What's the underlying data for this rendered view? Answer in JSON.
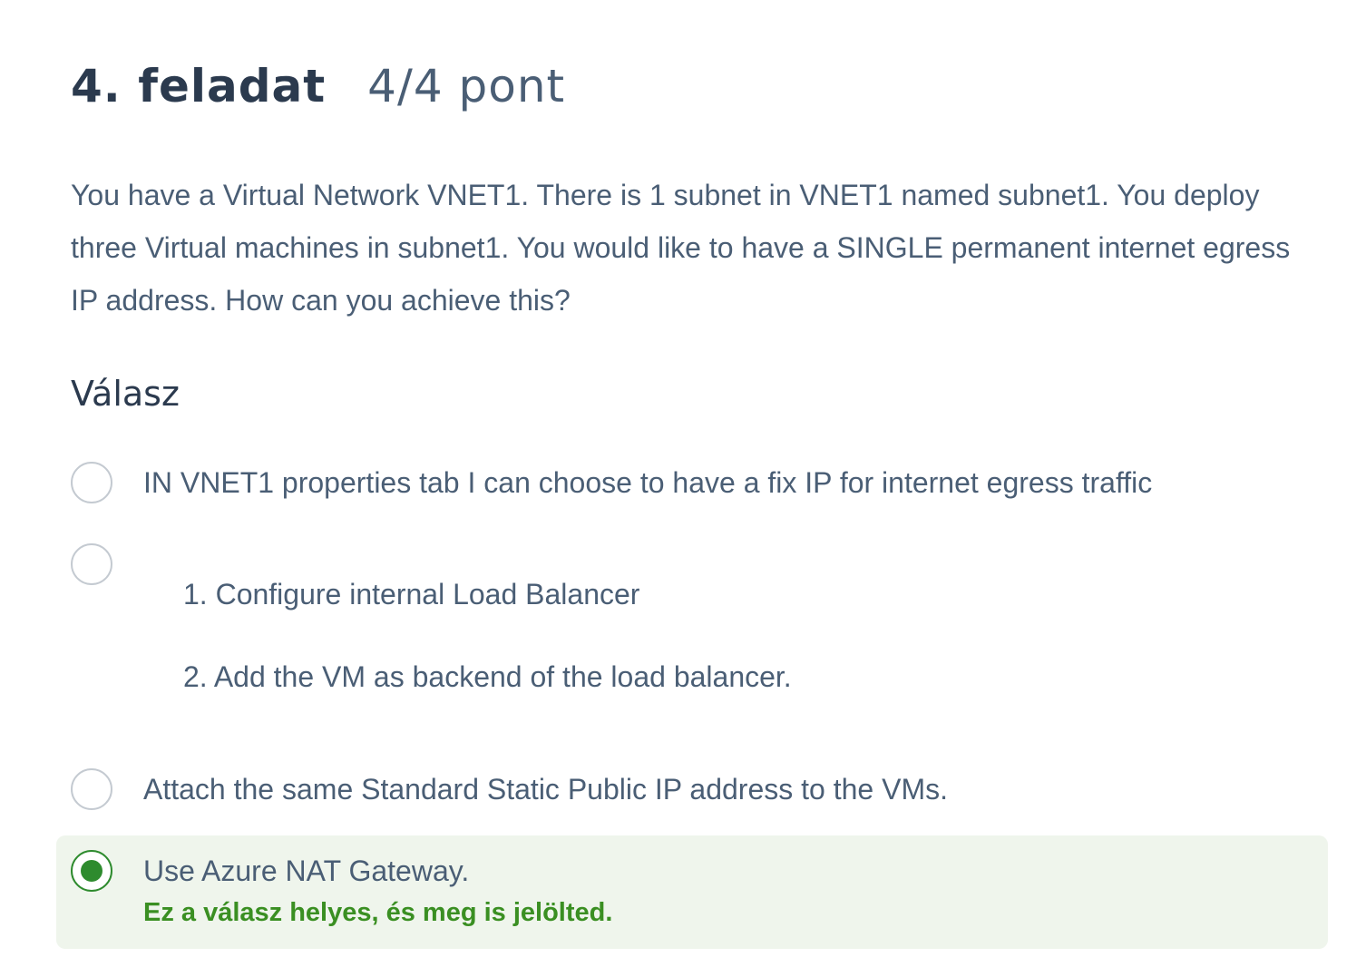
{
  "header": {
    "title": "4. feladat",
    "score": "4/4 pont"
  },
  "question": {
    "text": "You have a Virtual Network VNET1. There is 1 subnet in VNET1 named subnet1. You deploy three Virtual machines in subnet1. You would like to have a SINGLE permanent internet egress IP address. How can you achieve this?"
  },
  "answer": {
    "heading": "Válasz",
    "options": [
      {
        "label": "IN VNET1 properties tab I can choose to have a fix IP for internet egress traffic",
        "selected": false
      },
      {
        "steps": [
          "1. Configure internal Load Balancer",
          "2. Add the VM as backend of the load balancer."
        ],
        "selected": false
      },
      {
        "label": "Attach the same Standard Static Public IP address to the VMs.",
        "selected": false
      },
      {
        "label": "Use Azure NAT Gateway.",
        "selected": true,
        "feedback": "Ez a válasz helyes, és meg is jelölted."
      }
    ]
  },
  "colors": {
    "correct_green": "#3a8f22",
    "correct_bg": "#eff5ec",
    "text": "#4a5e75",
    "heading": "#2b3a4e"
  }
}
